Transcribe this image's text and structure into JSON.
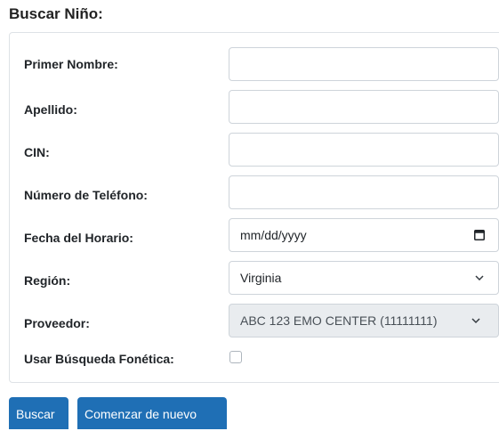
{
  "page_title": "Buscar Niño:",
  "form": {
    "first_name": {
      "label": "Primer Nombre:",
      "value": ""
    },
    "last_name": {
      "label": "Apellido:",
      "value": ""
    },
    "cin": {
      "label": "CIN:",
      "value": ""
    },
    "phone": {
      "label": "Número de Teléfono:",
      "value": ""
    },
    "schedule_date": {
      "label": "Fecha del Horario:",
      "placeholder": "mm/dd/yyyy"
    },
    "region": {
      "label": "Región:",
      "selected": "Virginia"
    },
    "provider": {
      "label": "Proveedor:",
      "selected": "ABC 123 EMO CENTER (11111111)"
    },
    "phonetic": {
      "label": "Usar Búsqueda Fonética:",
      "checked": false
    }
  },
  "buttons": {
    "search": "Buscar",
    "reset": "Comenzar de nuevo"
  },
  "colors": {
    "primary": "#1f6fb5",
    "disabled_bg": "#e9ecef",
    "border": "#ced4da"
  }
}
